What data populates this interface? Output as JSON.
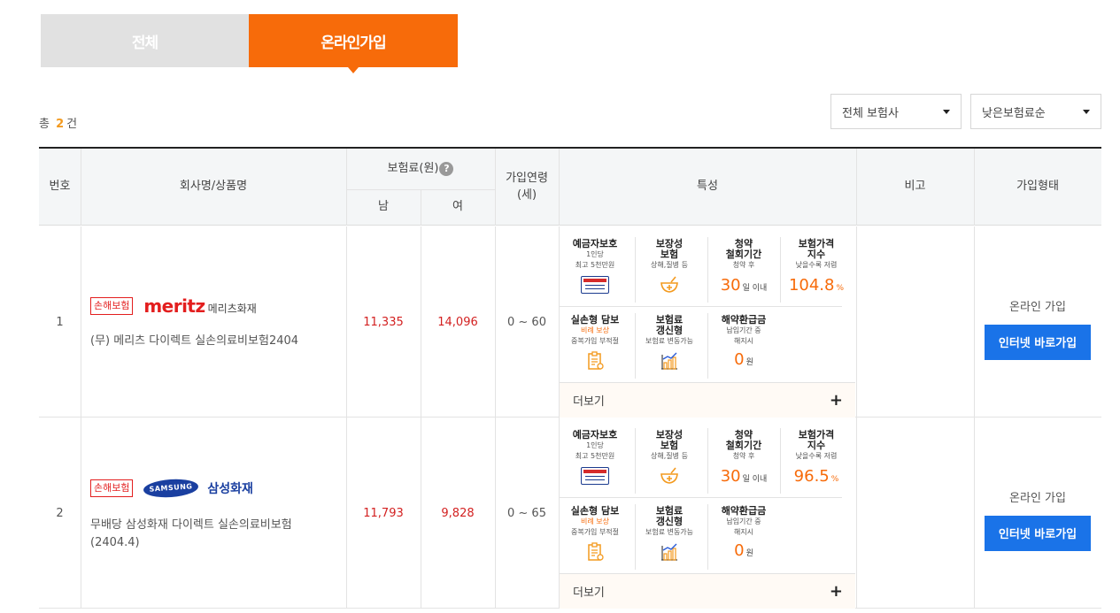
{
  "tabs": {
    "all": "전체",
    "online": "온라인가입"
  },
  "summary": {
    "prefix": "총",
    "count": "2",
    "suffix": "건"
  },
  "filters": {
    "company": "전체 보험사",
    "sort": "낮은보험료순"
  },
  "header": {
    "no": "번호",
    "company": "회사명/상품명",
    "premium": "보험료(원)",
    "male": "남",
    "female": "여",
    "age_line1": "가입연령",
    "age_line2": "(세)",
    "features": "특성",
    "note": "비고",
    "join": "가입형태"
  },
  "rows": [
    {
      "no": "1",
      "badge": "손해보험",
      "logo_word": "meritz",
      "logo_kor": "메리츠화재",
      "product": "(무) 메리츠 다이렉트 실손의료비보험2404",
      "male": "11,335",
      "female": "14,096",
      "age": "0 ~ 60",
      "features": {
        "f1_title": "예금자보호",
        "f1_sub1": "1인당",
        "f1_sub2": "최고 5천만원",
        "f2_title1": "보장성",
        "f2_title2": "보험",
        "f2_sub": "상해,질병 등",
        "f3_title1": "청약",
        "f3_title2": "철회기간",
        "f3_sub": "청약 후",
        "f3_value": "30",
        "f3_unit": "일 이내",
        "f4_title1": "보험가격",
        "f4_title2": "지수",
        "f4_sub": "낮을수록 저렴",
        "f4_value": "104.8",
        "f4_unit": "%",
        "f5_title": "실손형 담보",
        "f5_sub1": "비례 보상",
        "f5_sub2": "중복가입 부적절",
        "f6_title1": "보험료",
        "f6_title2": "갱신형",
        "f6_sub": "보험료 변동가능",
        "f7_title": "해약환급금",
        "f7_sub1": "납입기간 중",
        "f7_sub2": "해지시",
        "f7_value": "0",
        "f7_unit": "원"
      },
      "more": "더보기",
      "join_type": "온라인 가입",
      "join_button": "인터넷 바로가입"
    },
    {
      "no": "2",
      "badge": "손해보험",
      "logo_word": "SAMSUNG",
      "logo_kor": "삼성화재",
      "product": "무배당 삼성화재 다이렉트 실손의료비보험(2404.4)",
      "male": "11,793",
      "female": "9,828",
      "age": "0 ~ 65",
      "features": {
        "f1_title": "예금자보호",
        "f1_sub1": "1인당",
        "f1_sub2": "최고 5천만원",
        "f2_title1": "보장성",
        "f2_title2": "보험",
        "f2_sub": "상해,질병 등",
        "f3_title1": "청약",
        "f3_title2": "철회기간",
        "f3_sub": "청약 후",
        "f3_value": "30",
        "f3_unit": "일 이내",
        "f4_title1": "보험가격",
        "f4_title2": "지수",
        "f4_sub": "낮을수록 저렴",
        "f4_value": "96.5",
        "f4_unit": "%",
        "f5_title": "실손형 담보",
        "f5_sub1": "비례 보상",
        "f5_sub2": "중복가입 부적절",
        "f6_title1": "보험료",
        "f6_title2": "갱신형",
        "f6_sub": "보험료 변동가능",
        "f7_title": "해약환급금",
        "f7_sub1": "납입기간 중",
        "f7_sub2": "해지시",
        "f7_value": "0",
        "f7_unit": "원"
      },
      "more": "더보기",
      "join_type": "온라인 가입",
      "join_button": "인터넷 바로가입"
    }
  ],
  "colors": {
    "accent": "#f76b0a",
    "price": "#d32121",
    "button": "#1a73e8",
    "meritz": "#e31e1e",
    "samsung": "#1a3fa0"
  }
}
